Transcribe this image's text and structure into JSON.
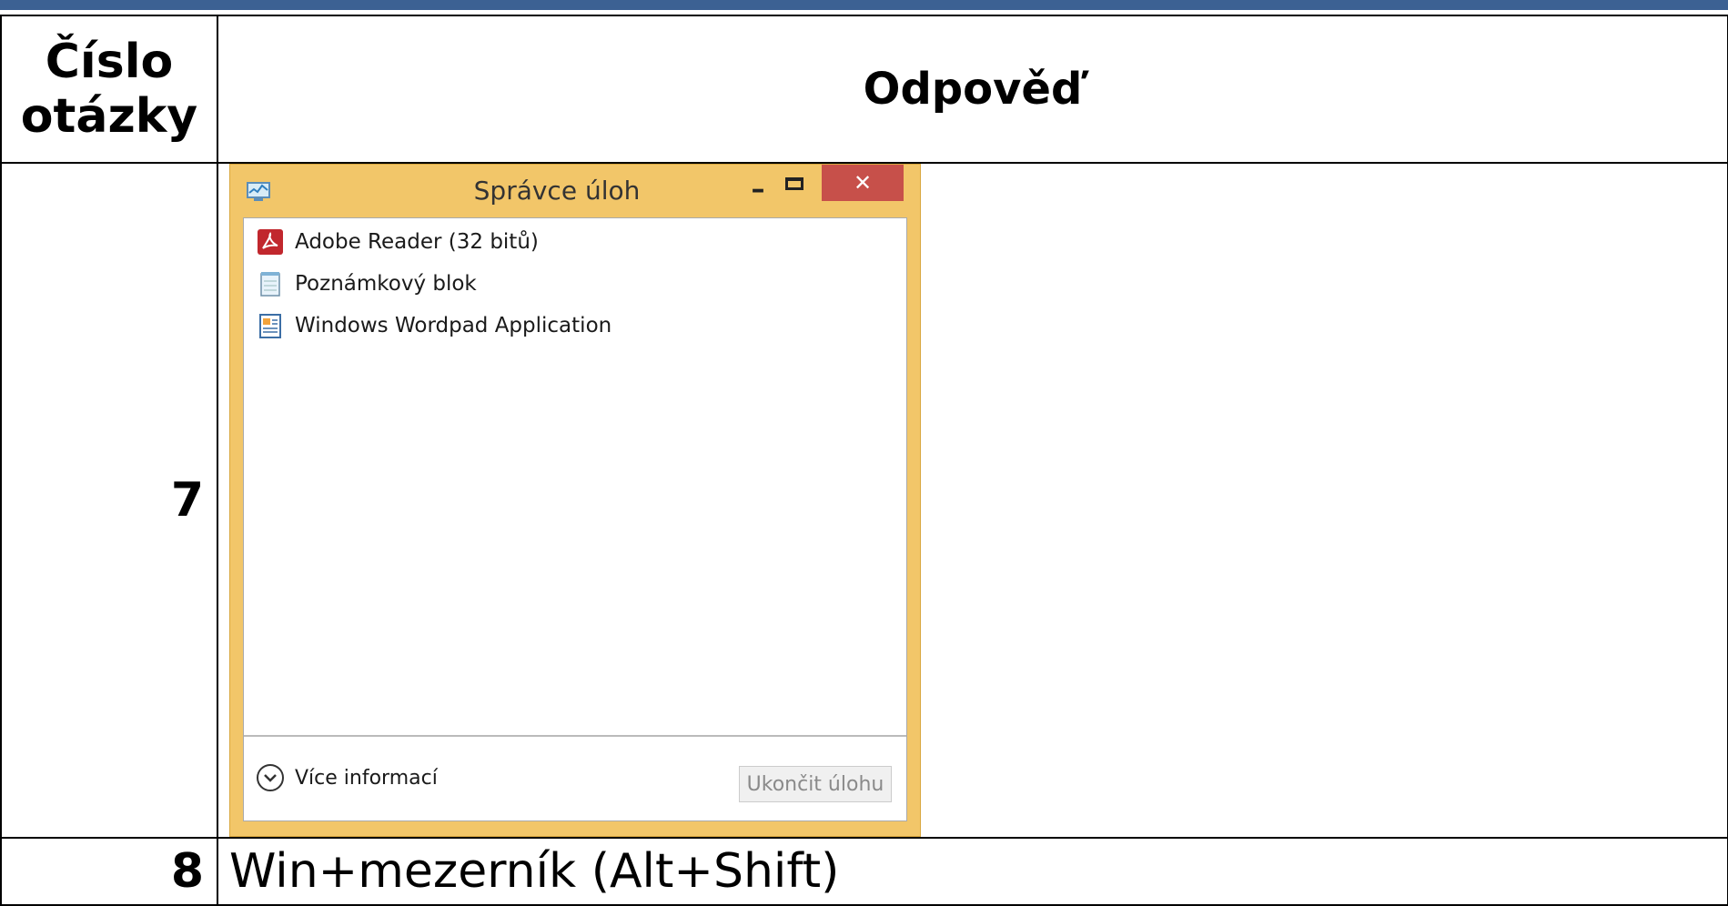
{
  "table": {
    "header_number": "Číslo otázky",
    "header_answer": "Odpověď",
    "rows": [
      {
        "number": "7"
      },
      {
        "number": "8",
        "answer": "Win+mezerník (Alt+Shift)"
      }
    ]
  },
  "task_manager": {
    "title": "Správce úloh",
    "processes": [
      {
        "label": "Adobe Reader (32 bitů)",
        "icon": "adobe-reader-icon"
      },
      {
        "label": "Poznámkový blok",
        "icon": "notepad-icon"
      },
      {
        "label": "Windows Wordpad Application",
        "icon": "wordpad-icon"
      }
    ],
    "more_info": "Více informací",
    "end_task": "Ukončit úlohu",
    "colors": {
      "frame": "#f2c669",
      "close": "#c7504a",
      "topbar": "#3c6193"
    }
  }
}
